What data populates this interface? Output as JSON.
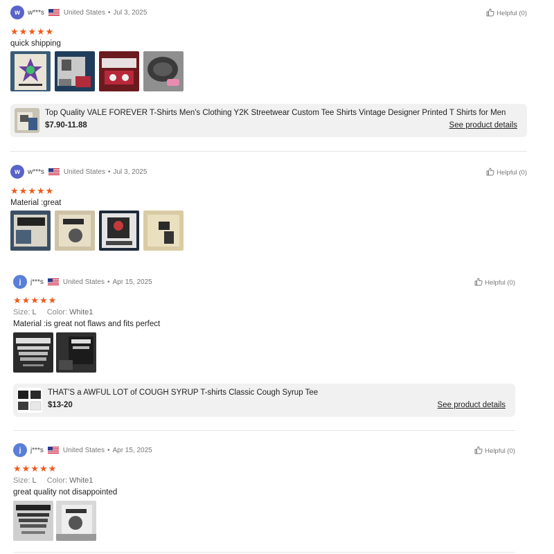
{
  "reviews": [
    {
      "avatar_letter": "w",
      "username": "w***s",
      "country": "United States",
      "date": "Jul 3, 2025",
      "helpful": "Helpful (0)",
      "rating": 5,
      "text": "quick shipping",
      "product": {
        "title": "Top Quality VALE FOREVER T-Shirts Men's Clothing Y2K Streetwear Custom Tee Shirts Vintage Designer Printed T Shirts for Men",
        "price": "$7.90-11.88",
        "link": "See product details"
      }
    },
    {
      "avatar_letter": "w",
      "username": "w***s",
      "country": "United States",
      "date": "Jul 3, 2025",
      "helpful": "Helpful (0)",
      "rating": 5,
      "text": "Material :great"
    },
    {
      "avatar_letter": "j",
      "username": "j***s",
      "country": "United States",
      "date": "Apr 15, 2025",
      "helpful": "Helpful (0)",
      "rating": 5,
      "size_label": "Size:",
      "size_value": "L",
      "color_label": "Color:",
      "color_value": "White1",
      "text": "Material :is great not flaws and fits perfect",
      "product": {
        "title": "THAT'S a AWFUL LOT of COUGH SYRUP T-shirts Classic Cough Syrup Tee",
        "price": "$13-20",
        "link": "See product details"
      }
    },
    {
      "avatar_letter": "j",
      "username": "j***s",
      "country": "United States",
      "date": "Apr 15, 2025",
      "helpful": "Helpful (0)",
      "rating": 5,
      "size_label": "Size:",
      "size_value": "L",
      "color_label": "Color:",
      "color_value": "White1",
      "text": "great quality not disappointed"
    }
  ],
  "colors": {
    "star": "#f05a1a",
    "avatar": "#5a63c8",
    "product_bg": "#f1f1f1"
  },
  "icons": {
    "helpful": "thumbs-up-icon",
    "flag": "us-flag-icon",
    "star": "star-icon"
  }
}
